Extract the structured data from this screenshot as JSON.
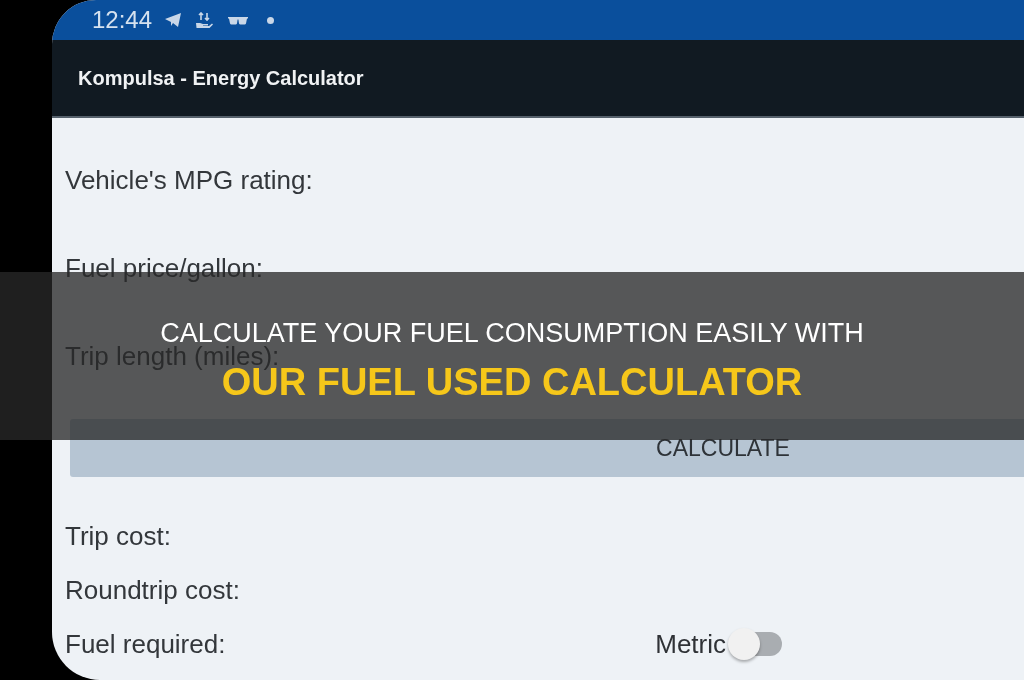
{
  "status_bar": {
    "time": "12:44"
  },
  "app_bar": {
    "title": "Kompulsa - Energy Calculator"
  },
  "fields": [
    {
      "label": "Vehicle's MPG rating:"
    },
    {
      "label": "Fuel price/gallon:"
    },
    {
      "label": "Trip length (miles):"
    }
  ],
  "calculate_button": {
    "label": "CALCULATE"
  },
  "results": [
    {
      "label": "Trip cost:"
    },
    {
      "label": "Roundtrip cost:"
    },
    {
      "label": "Fuel required:"
    }
  ],
  "metric_switch": {
    "label": "Metric",
    "on": false
  },
  "headline": [
    {
      "text": "CALCULATE YOUR FUEL CONSUMPTION EASILY WITH",
      "kind": "plain"
    },
    {
      "text": "OUR FUEL USED CALCULATOR",
      "kind": "highlight"
    }
  ]
}
